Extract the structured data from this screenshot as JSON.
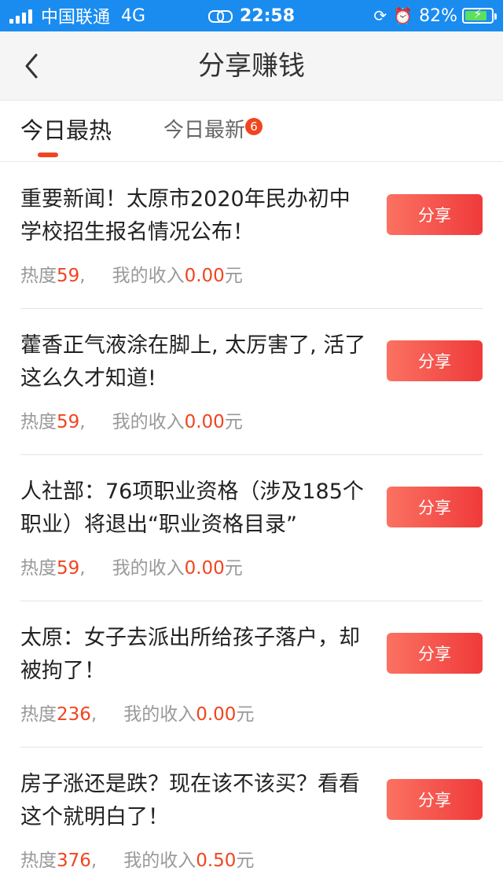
{
  "status_bar": {
    "carrier": "中国联通",
    "network": "4G",
    "time": "22:58",
    "battery": "82%",
    "battery_level": 0.82,
    "icons": [
      "signal-icon",
      "link-icon",
      "rotation-lock-icon",
      "alarm-icon",
      "battery-charging-icon"
    ]
  },
  "nav": {
    "title": "分享赚钱",
    "back_icon": "chevron-left-icon"
  },
  "tabs": {
    "hot": "今日最热",
    "new": "今日最新",
    "new_badge": "6"
  },
  "meta_labels": {
    "heat": "热度",
    "income": "我的收入",
    "unit": "元",
    "comma": ","
  },
  "share_label": "分享",
  "colors": {
    "status_bar": "#1a8cf0",
    "accent": "#f0451f",
    "button_start": "#fb7262",
    "button_end": "#ef3a3a"
  },
  "items": [
    {
      "title": "重要新闻！太原市2020年民办初中学校招生报名情况公布！",
      "heat": "59",
      "income": "0.00"
    },
    {
      "title": "藿香正气液涂在脚上, 太厉害了, 活了这么久才知道!",
      "heat": "59",
      "income": "0.00"
    },
    {
      "title": "人社部：76项职业资格（涉及185个职业）将退出“职业资格目录”",
      "heat": "59",
      "income": "0.00"
    },
    {
      "title": "太原：女子去派出所给孩子落户，却被拘了！",
      "heat": "236",
      "income": "0.00"
    },
    {
      "title": "房子涨还是跌？现在该不该买？看看这个就明白了！",
      "heat": "376",
      "income": "0.50"
    }
  ]
}
